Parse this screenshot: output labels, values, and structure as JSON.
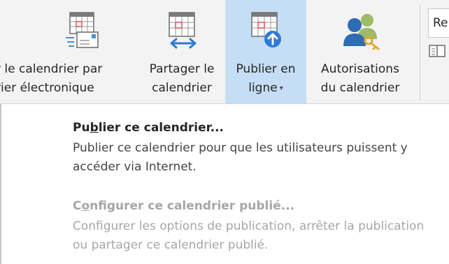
{
  "ribbon": {
    "buttons": [
      {
        "line1": "r le calendrier par",
        "line2": "rier électronique"
      },
      {
        "line1": "Partager le",
        "line2": "calendrier"
      },
      {
        "line1": "Publier en",
        "line2": "ligne",
        "dropdown_caret": "▾",
        "active": true
      },
      {
        "line1": "Autorisations",
        "line2": "du calendrier"
      }
    ],
    "side_input_text": "Re"
  },
  "menu": {
    "items": [
      {
        "title_pre": "Pu",
        "title_mnemonic": "b",
        "title_post": "lier ce calendrier...",
        "description": "Publier ce calendrier pour que les utilisateurs puissent y accéder via Internet.",
        "enabled": true
      },
      {
        "title_pre": "C",
        "title_mnemonic": "o",
        "title_post": "nfigurer ce calendrier publié...",
        "description": "Configurer les options de publication, arrêter la publication ou partager ce calendrier publié.",
        "enabled": false
      }
    ]
  },
  "colors": {
    "ribbon_bg": "#f3f3f3",
    "active_bg": "#c5def5",
    "calendar_red": "#d9534f",
    "accent_blue": "#2e7bd6",
    "disabled_text": "#a6a6a6"
  }
}
